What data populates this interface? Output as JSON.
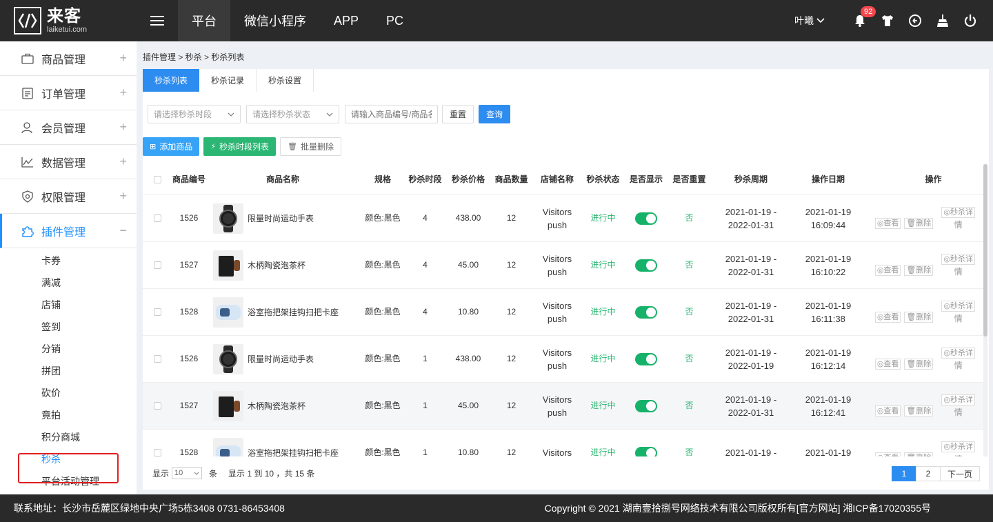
{
  "brand": {
    "name_cn": "来客",
    "name_en": "laiketui.com"
  },
  "topnav": [
    "平台",
    "微信小程序",
    "APP",
    "PC"
  ],
  "user": {
    "name": "叶曦",
    "notification_count": "92"
  },
  "sidebar": {
    "menus": [
      {
        "label": "商品管理",
        "icon": "briefcase-icon",
        "sign": "+"
      },
      {
        "label": "订单管理",
        "icon": "clipboard-icon",
        "sign": "+"
      },
      {
        "label": "会员管理",
        "icon": "user-icon",
        "sign": "+"
      },
      {
        "label": "数据管理",
        "icon": "chart-icon",
        "sign": "+"
      },
      {
        "label": "权限管理",
        "icon": "shield-icon",
        "sign": "+"
      },
      {
        "label": "插件管理",
        "icon": "puzzle-icon",
        "sign": "−"
      }
    ],
    "submenu": [
      "卡券",
      "满减",
      "店铺",
      "签到",
      "分销",
      "拼团",
      "砍价",
      "竟拍",
      "积分商城",
      "秒杀",
      "平台活动管理"
    ]
  },
  "breadcrumb": "插件管理 > 秒杀 > 秒杀列表",
  "tabs": [
    "秒杀列表",
    "秒杀记录",
    "秒杀设置"
  ],
  "filters": {
    "slot_placeholder": "请选择秒杀时段",
    "status_placeholder": "请选择秒杀状态",
    "search_placeholder": "请输入商品编号/商品名称",
    "reset_label": "重置",
    "query_label": "查询"
  },
  "actions": {
    "add": "添加商品",
    "slots": "秒杀时段列表",
    "batch_delete": "批量删除"
  },
  "table": {
    "headers": [
      "商品编号",
      "商品名称",
      "规格",
      "秒杀时段",
      "秒杀价格",
      "商品数量",
      "店铺名称",
      "秒杀状态",
      "是否显示",
      "是否重置",
      "秒杀周期",
      "操作日期",
      "操作"
    ],
    "rows": [
      {
        "id": "1526",
        "name": "限量时尚运动手表",
        "img": "watch",
        "spec": "颜色:黑色",
        "slot": "4",
        "price": "438.00",
        "qty": "12",
        "shop1": "Visitors",
        "shop2": "push",
        "status": "进行中",
        "reset": "否",
        "cycle1": "2021-01-19 -",
        "cycle2": "2022-01-31",
        "date1": "2021-01-19",
        "date2": "16:09:44"
      },
      {
        "id": "1527",
        "name": "木柄陶瓷泡茶杯",
        "img": "mug",
        "spec": "颜色:黑色",
        "slot": "4",
        "price": "45.00",
        "qty": "12",
        "shop1": "Visitors",
        "shop2": "push",
        "status": "进行中",
        "reset": "否",
        "cycle1": "2021-01-19 -",
        "cycle2": "2022-01-31",
        "date1": "2021-01-19",
        "date2": "16:10:22"
      },
      {
        "id": "1528",
        "name": "浴室拖把架挂钩扫把卡座",
        "img": "holder",
        "spec": "颜色:黑色",
        "slot": "4",
        "price": "10.80",
        "qty": "12",
        "shop1": "Visitors",
        "shop2": "push",
        "status": "进行中",
        "reset": "否",
        "cycle1": "2021-01-19 -",
        "cycle2": "2022-01-31",
        "date1": "2021-01-19",
        "date2": "16:11:38"
      },
      {
        "id": "1526",
        "name": "限量时尚运动手表",
        "img": "watch",
        "spec": "颜色:黑色",
        "slot": "1",
        "price": "438.00",
        "qty": "12",
        "shop1": "Visitors",
        "shop2": "push",
        "status": "进行中",
        "reset": "否",
        "cycle1": "2021-01-19 -",
        "cycle2": "2022-01-19",
        "date1": "2021-01-19",
        "date2": "16:12:14"
      },
      {
        "id": "1527",
        "name": "木柄陶瓷泡茶杯",
        "img": "mug",
        "spec": "颜色:黑色",
        "slot": "1",
        "price": "45.00",
        "qty": "12",
        "shop1": "Visitors",
        "shop2": "push",
        "status": "进行中",
        "reset": "否",
        "cycle1": "2021-01-19 -",
        "cycle2": "2022-01-31",
        "date1": "2021-01-19",
        "date2": "16:12:41"
      },
      {
        "id": "1528",
        "name": "浴室拖把架挂钩扫把卡座",
        "img": "holder",
        "spec": "颜色:黑色",
        "slot": "1",
        "price": "10.80",
        "qty": "12",
        "shop1": "Visitors",
        "shop2": "",
        "status": "进行中",
        "reset": "否",
        "cycle1": "2021-01-19 -",
        "cycle2": "",
        "date1": "2021-01-19",
        "date2": ""
      }
    ],
    "ops": {
      "view": "查看",
      "delete": "删除",
      "detail_a": "秒杀详",
      "detail_b": "情"
    }
  },
  "pager": {
    "show_label": "显示",
    "page_size": "10",
    "unit": "条",
    "summary": "显示 1 到 10 ，共 15 条",
    "pages": [
      "1",
      "2"
    ],
    "next": "下一页"
  },
  "footer": {
    "left": "联系地址：长沙市岳麓区绿地中央广场5栋3408 0731-86453408",
    "right": "Copyright © 2021 湖南壹拾捌号网络技术有限公司版权所有[官方网站]   湘ICP备17020355号"
  },
  "colors": {
    "primary": "#2d8cf0",
    "success": "#2bb673",
    "topbar": "#2a2a2a",
    "highlight": "#e02020"
  }
}
